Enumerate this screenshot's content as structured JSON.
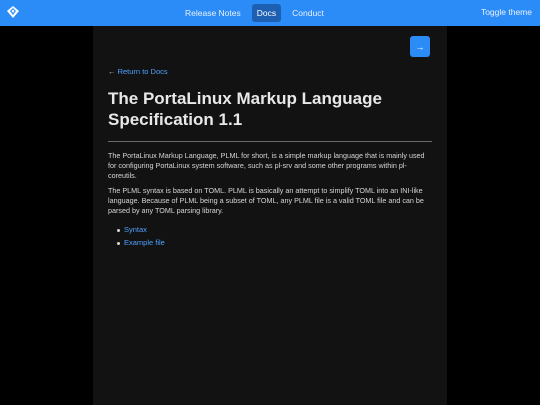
{
  "header": {
    "logo_icon": "logo-diamond-icon",
    "nav": [
      {
        "label": "Release Notes",
        "active": false
      },
      {
        "label": "Docs",
        "active": true
      },
      {
        "label": "Conduct",
        "active": false
      }
    ],
    "toggle_theme": "Toggle theme"
  },
  "page": {
    "next_button_label": "→",
    "back_link": "Return to Docs",
    "back_arrow": "←",
    "title": "The PortaLinux Markup Language Specification 1.1",
    "paragraphs": [
      "The PortaLinux Markup Language, PLML for short, is a simple markup language that is mainly used for configuring PortaLinux system software, such as pl-srv and some other programs within pl-coreutils.",
      "The PLML syntax is based on TOML. PLML is basically an attempt to simplify TOML into an INI-like language. Because of PLML being a subset of TOML, any PLML file is a valid TOML file and can be parsed by any TOML parsing library."
    ],
    "links": [
      "Syntax",
      "Example file"
    ]
  },
  "colors": {
    "accent": "#2b8cf7",
    "link": "#4ea0ff",
    "background": "#000000",
    "panel": "#121212"
  }
}
